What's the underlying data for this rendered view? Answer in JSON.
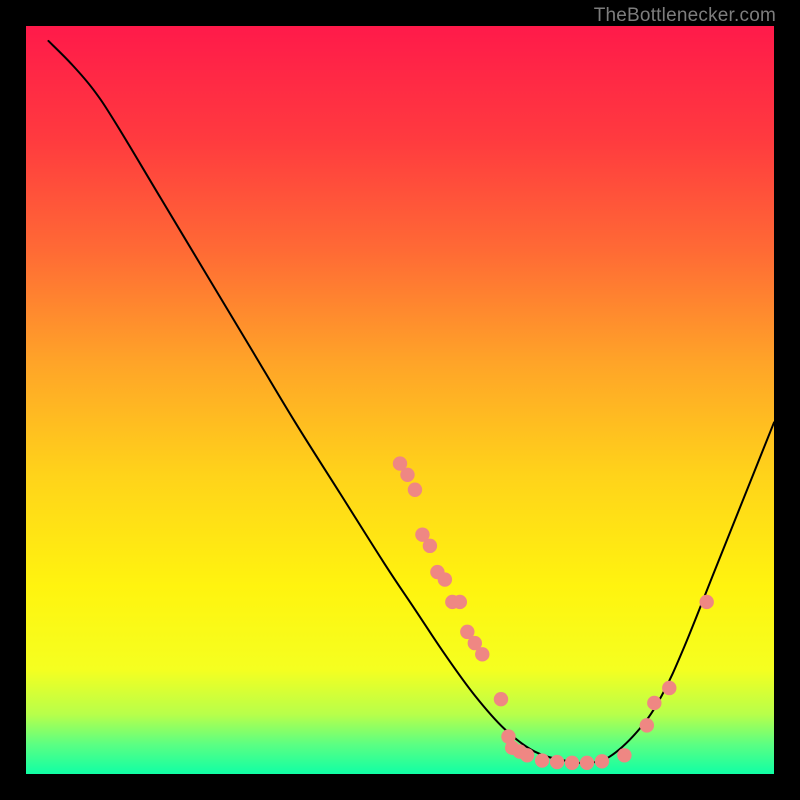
{
  "watermark": "TheBottlenecker.com",
  "chart_data": {
    "type": "line",
    "title": "",
    "xlabel": "",
    "ylabel": "",
    "xlim": [
      0,
      100
    ],
    "ylim": [
      0,
      100
    ],
    "background": "rainbow-gradient",
    "curve": [
      {
        "x": 3.0,
        "y": 98.0
      },
      {
        "x": 6.0,
        "y": 95.0
      },
      {
        "x": 9.0,
        "y": 91.5
      },
      {
        "x": 12.0,
        "y": 87.0
      },
      {
        "x": 18.0,
        "y": 77.0
      },
      {
        "x": 24.0,
        "y": 67.0
      },
      {
        "x": 30.0,
        "y": 57.0
      },
      {
        "x": 36.0,
        "y": 47.0
      },
      {
        "x": 42.0,
        "y": 37.5
      },
      {
        "x": 48.0,
        "y": 28.0
      },
      {
        "x": 52.0,
        "y": 22.0
      },
      {
        "x": 56.0,
        "y": 16.0
      },
      {
        "x": 60.0,
        "y": 10.5
      },
      {
        "x": 64.0,
        "y": 6.0
      },
      {
        "x": 68.0,
        "y": 3.0
      },
      {
        "x": 72.0,
        "y": 1.8
      },
      {
        "x": 75.0,
        "y": 1.5
      },
      {
        "x": 78.0,
        "y": 2.3
      },
      {
        "x": 82.0,
        "y": 6.0
      },
      {
        "x": 85.0,
        "y": 10.5
      },
      {
        "x": 88.0,
        "y": 17.0
      },
      {
        "x": 92.0,
        "y": 27.0
      },
      {
        "x": 96.0,
        "y": 37.0
      },
      {
        "x": 100.0,
        "y": 47.0
      }
    ],
    "scatter": [
      {
        "x": 50.0,
        "y": 41.5
      },
      {
        "x": 51.0,
        "y": 40.0
      },
      {
        "x": 52.0,
        "y": 38.0
      },
      {
        "x": 53.0,
        "y": 32.0
      },
      {
        "x": 54.0,
        "y": 30.5
      },
      {
        "x": 55.0,
        "y": 27.0
      },
      {
        "x": 56.0,
        "y": 26.0
      },
      {
        "x": 57.0,
        "y": 23.0
      },
      {
        "x": 58.0,
        "y": 23.0
      },
      {
        "x": 59.0,
        "y": 19.0
      },
      {
        "x": 60.0,
        "y": 17.5
      },
      {
        "x": 61.0,
        "y": 16.0
      },
      {
        "x": 63.5,
        "y": 10.0
      },
      {
        "x": 64.5,
        "y": 5.0
      },
      {
        "x": 65.0,
        "y": 3.5
      },
      {
        "x": 66.0,
        "y": 3.0
      },
      {
        "x": 67.0,
        "y": 2.5
      },
      {
        "x": 69.0,
        "y": 1.8
      },
      {
        "x": 71.0,
        "y": 1.6
      },
      {
        "x": 73.0,
        "y": 1.5
      },
      {
        "x": 75.0,
        "y": 1.5
      },
      {
        "x": 77.0,
        "y": 1.7
      },
      {
        "x": 80.0,
        "y": 2.5
      },
      {
        "x": 83.0,
        "y": 6.5
      },
      {
        "x": 84.0,
        "y": 9.5
      },
      {
        "x": 86.0,
        "y": 11.5
      },
      {
        "x": 91.0,
        "y": 23.0
      }
    ],
    "scatter_color": "#ef8783",
    "curve_color": "#000000",
    "gradient_stops": [
      {
        "offset": 0.0,
        "color": "#ff1a4a"
      },
      {
        "offset": 0.15,
        "color": "#ff3a3f"
      },
      {
        "offset": 0.3,
        "color": "#ff6a35"
      },
      {
        "offset": 0.45,
        "color": "#ffa428"
      },
      {
        "offset": 0.6,
        "color": "#ffd31a"
      },
      {
        "offset": 0.75,
        "color": "#fff40f"
      },
      {
        "offset": 0.86,
        "color": "#f5ff20"
      },
      {
        "offset": 0.92,
        "color": "#b8ff4a"
      },
      {
        "offset": 0.96,
        "color": "#5cff82"
      },
      {
        "offset": 1.0,
        "color": "#10ffa5"
      }
    ]
  }
}
